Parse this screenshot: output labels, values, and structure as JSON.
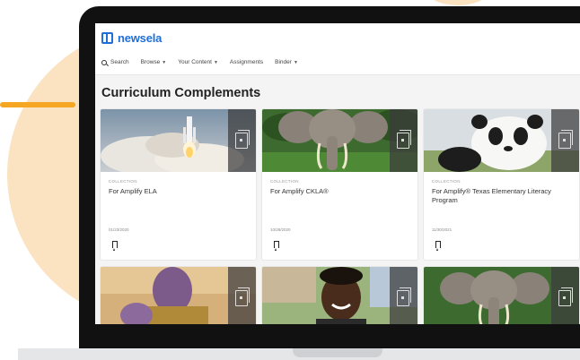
{
  "app": {
    "brand": "newsela"
  },
  "nav": {
    "search": "Search",
    "items": [
      {
        "label": "Browse"
      },
      {
        "label": "Your Content"
      },
      {
        "label": "Assignments"
      },
      {
        "label": "Binder"
      }
    ]
  },
  "page": {
    "title": "Curriculum Complements"
  },
  "cards": [
    {
      "type": "COLLECTION",
      "title": "For Amplify ELA",
      "date": "01/23/2020",
      "image": "rocket-launch"
    },
    {
      "type": "COLLECTION",
      "title": "For Amplify CKLA®",
      "date": "10/28/2020",
      "image": "elephant"
    },
    {
      "type": "COLLECTION",
      "title": "For Amplify® Texas Elementary Literacy Program",
      "date": "11/30/2021",
      "image": "panda"
    },
    {
      "image": "thanos-character"
    },
    {
      "image": "smiling-student"
    },
    {
      "image": "elephant"
    }
  ],
  "colors": {
    "brand": "#1f6fd6",
    "accent": "#f5a623",
    "blob": "#fbe3c2"
  }
}
